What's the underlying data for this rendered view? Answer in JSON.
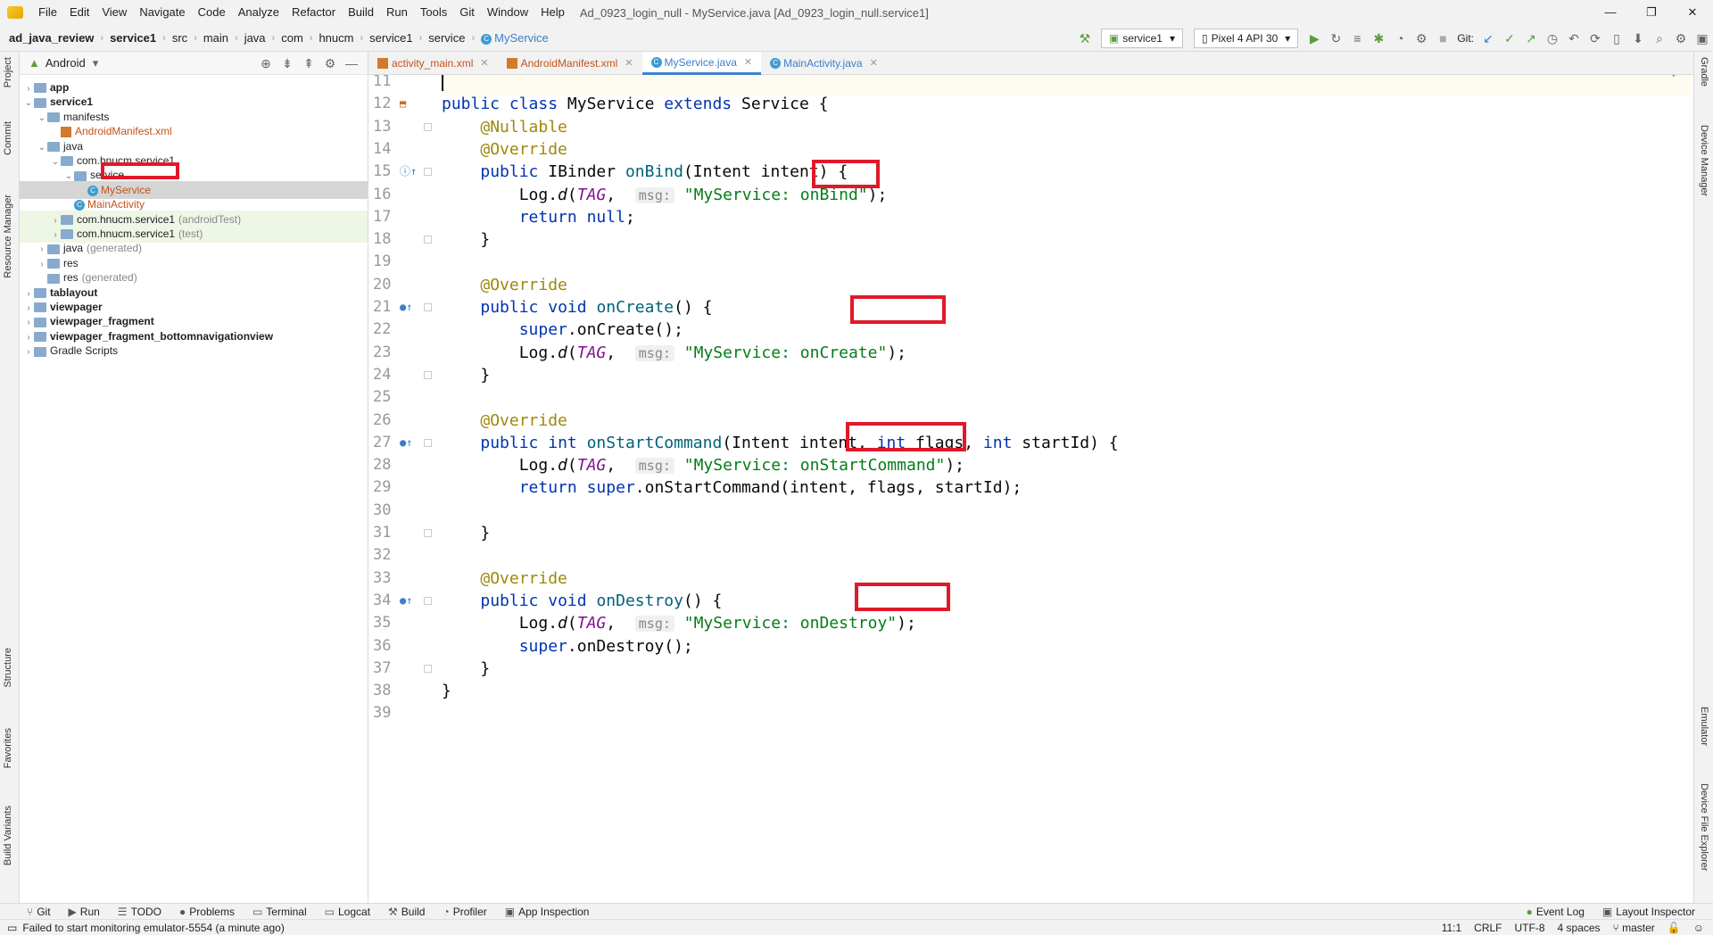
{
  "menu": [
    "File",
    "Edit",
    "View",
    "Navigate",
    "Code",
    "Analyze",
    "Refactor",
    "Build",
    "Run",
    "Tools",
    "Git",
    "Window",
    "Help"
  ],
  "window_title": "Ad_0923_login_null - MyService.java [Ad_0923_login_null.service1]",
  "breadcrumb": [
    "ad_java_review",
    "service1",
    "src",
    "main",
    "java",
    "com",
    "hnucm",
    "service1",
    "service",
    "MyService"
  ],
  "toolbar": {
    "run_config": "service1",
    "device": "Pixel 4 API 30",
    "git_label": "Git:"
  },
  "left_strip": [
    "Project",
    "Commit",
    "Resource Manager",
    "Structure",
    "Favorites",
    "Build Variants"
  ],
  "right_strip": [
    "Gradle",
    "Device Manager",
    "Emulator",
    "Device File Explorer"
  ],
  "project": {
    "view": "Android",
    "tree": [
      {
        "label": "app",
        "extra": "",
        "bold": true,
        "depth": 0,
        "arrow": "›"
      },
      {
        "label": "service1",
        "extra": "",
        "bold": true,
        "depth": 0,
        "arrow": "⌄"
      },
      {
        "label": "manifests",
        "extra": "",
        "bold": false,
        "depth": 1,
        "arrow": "⌄"
      },
      {
        "label": "AndroidManifest.xml",
        "extra": "",
        "bold": false,
        "depth": 2,
        "arrow": ""
      },
      {
        "label": "java",
        "extra": "",
        "bold": false,
        "depth": 1,
        "arrow": "⌄"
      },
      {
        "label": "com.hnucm.service1",
        "extra": "",
        "bold": false,
        "depth": 2,
        "arrow": "⌄"
      },
      {
        "label": "service",
        "extra": "",
        "bold": false,
        "depth": 3,
        "arrow": "⌄"
      },
      {
        "label": "MyService",
        "extra": "",
        "bold": false,
        "depth": 4,
        "arrow": ""
      },
      {
        "label": "MainActivity",
        "extra": "",
        "bold": false,
        "depth": 3,
        "arrow": ""
      },
      {
        "label": "com.hnucm.service1",
        "extra": "(androidTest)",
        "bold": false,
        "depth": 2,
        "arrow": "›"
      },
      {
        "label": "com.hnucm.service1",
        "extra": "(test)",
        "bold": false,
        "depth": 2,
        "arrow": "›"
      },
      {
        "label": "java",
        "extra": "(generated)",
        "bold": false,
        "depth": 1,
        "arrow": "›"
      },
      {
        "label": "res",
        "extra": "",
        "bold": false,
        "depth": 1,
        "arrow": "›"
      },
      {
        "label": "res",
        "extra": "(generated)",
        "bold": false,
        "depth": 1,
        "arrow": ""
      },
      {
        "label": "tablayout",
        "extra": "",
        "bold": true,
        "depth": 0,
        "arrow": "›"
      },
      {
        "label": "viewpager",
        "extra": "",
        "bold": true,
        "depth": 0,
        "arrow": "›"
      },
      {
        "label": "viewpager_fragment",
        "extra": "",
        "bold": true,
        "depth": 0,
        "arrow": "›"
      },
      {
        "label": "viewpager_fragment_bottomnavigationview",
        "extra": "",
        "bold": true,
        "depth": 0,
        "arrow": "›"
      },
      {
        "label": "Gradle Scripts",
        "extra": "",
        "bold": false,
        "depth": 0,
        "arrow": "›"
      }
    ]
  },
  "tabs": [
    "activity_main.xml",
    "AndroidManifest.xml",
    "MyService.java",
    "MainActivity.java"
  ],
  "code_lines": [
    {
      "n": "11",
      "t": ""
    },
    {
      "n": "12",
      "t": "public class MyService extends Service {"
    },
    {
      "n": "13",
      "t": "    @Nullable"
    },
    {
      "n": "14",
      "t": "    @Override"
    },
    {
      "n": "15",
      "t": "    public IBinder onBind(Intent intent) {"
    },
    {
      "n": "16",
      "t": "        Log.d(TAG,  msg: \"MyService: onBind\");"
    },
    {
      "n": "17",
      "t": "        return null;"
    },
    {
      "n": "18",
      "t": "    }"
    },
    {
      "n": "19",
      "t": ""
    },
    {
      "n": "20",
      "t": "    @Override"
    },
    {
      "n": "21",
      "t": "    public void onCreate() {"
    },
    {
      "n": "22",
      "t": "        super.onCreate();"
    },
    {
      "n": "23",
      "t": "        Log.d(TAG,  msg: \"MyService: onCreate\");"
    },
    {
      "n": "24",
      "t": "    }"
    },
    {
      "n": "25",
      "t": ""
    },
    {
      "n": "26",
      "t": "    @Override"
    },
    {
      "n": "27",
      "t": "    public int onStartCommand(Intent intent, int flags, int startId) {"
    },
    {
      "n": "28",
      "t": "        Log.d(TAG,  msg: \"MyService: onStartCommand\");"
    },
    {
      "n": "29",
      "t": "        return super.onStartCommand(intent, flags, startId);"
    },
    {
      "n": "30",
      "t": ""
    },
    {
      "n": "31",
      "t": "    }"
    },
    {
      "n": "32",
      "t": ""
    },
    {
      "n": "33",
      "t": "    @Override"
    },
    {
      "n": "34",
      "t": "    public void onDestroy() {"
    },
    {
      "n": "35",
      "t": "        Log.d(TAG,  msg: \"MyService: onDestroy\");"
    },
    {
      "n": "36",
      "t": "        super.onDestroy();"
    },
    {
      "n": "37",
      "t": "    }"
    },
    {
      "n": "38",
      "t": "}"
    },
    {
      "n": "39",
      "t": ""
    }
  ],
  "bottom_tools": [
    "Git",
    "Run",
    "TODO",
    "Problems",
    "Terminal",
    "Logcat",
    "Build",
    "Profiler",
    "App Inspection"
  ],
  "bottom_right": [
    "Event Log",
    "Layout Inspector"
  ],
  "status": {
    "message": "Failed to start monitoring emulator-5554 (a minute ago)",
    "position": "11:1",
    "line_sep": "CRLF",
    "encoding": "UTF-8",
    "indent": "4 spaces",
    "branch": "master"
  },
  "colors": {
    "highlight_box": "#e0192a",
    "keyword": "#0033b3",
    "annotation": "#9e880d",
    "string": "#067d17"
  }
}
